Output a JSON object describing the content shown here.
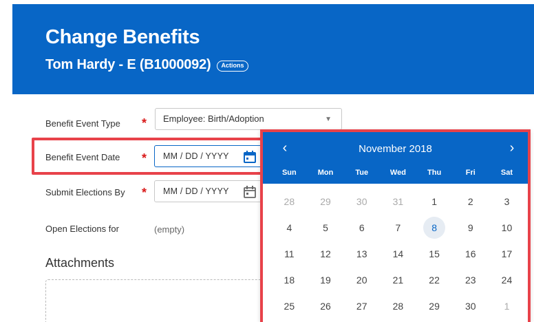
{
  "header": {
    "title": "Change Benefits",
    "worker": "Tom Hardy - E (B1000092)",
    "actions_label": "Actions"
  },
  "form": {
    "event_type_label": "Benefit Event Type",
    "event_type_value": "Employee: Birth/Adoption",
    "event_date_label": "Benefit Event Date",
    "event_date_placeholder": "MM / DD / YYYY",
    "submit_by_label": "Submit Elections By",
    "submit_by_placeholder": "MM / DD / YYYY",
    "open_elections_label": "Open Elections for",
    "open_elections_value": "(empty)",
    "required_mark": "*",
    "attachments_heading": "Attachments"
  },
  "calendar": {
    "prev_glyph": "‹",
    "next_glyph": "›",
    "month_label": "November 2018",
    "weekdays": [
      "Sun",
      "Mon",
      "Tue",
      "Wed",
      "Thu",
      "Fri",
      "Sat"
    ],
    "days": [
      {
        "label": "28",
        "muted": true
      },
      {
        "label": "29",
        "muted": true
      },
      {
        "label": "30",
        "muted": true
      },
      {
        "label": "31",
        "muted": true
      },
      {
        "label": "1"
      },
      {
        "label": "2"
      },
      {
        "label": "3"
      },
      {
        "label": "4"
      },
      {
        "label": "5"
      },
      {
        "label": "6"
      },
      {
        "label": "7"
      },
      {
        "label": "8",
        "today": true
      },
      {
        "label": "9"
      },
      {
        "label": "10"
      },
      {
        "label": "11"
      },
      {
        "label": "12"
      },
      {
        "label": "13"
      },
      {
        "label": "14"
      },
      {
        "label": "15"
      },
      {
        "label": "16"
      },
      {
        "label": "17"
      },
      {
        "label": "18"
      },
      {
        "label": "19"
      },
      {
        "label": "20"
      },
      {
        "label": "21"
      },
      {
        "label": "22"
      },
      {
        "label": "23"
      },
      {
        "label": "24"
      },
      {
        "label": "25"
      },
      {
        "label": "26"
      },
      {
        "label": "27"
      },
      {
        "label": "28"
      },
      {
        "label": "29"
      },
      {
        "label": "30"
      },
      {
        "label": "1",
        "muted": true
      }
    ]
  },
  "colors": {
    "brand_blue": "#0866c6",
    "required_red": "#d91a1a",
    "highlight_red": "#e8424a"
  }
}
